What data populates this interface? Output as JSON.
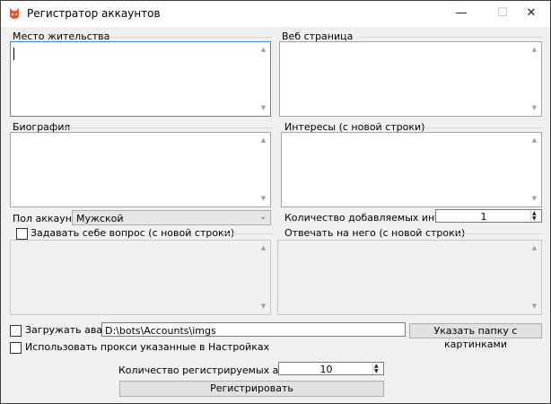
{
  "window": {
    "title": "Регистратор аккаунтов",
    "controls": {
      "minimize": "—",
      "maximize": "☐",
      "close": "✕"
    }
  },
  "groups": {
    "residence": "Место жительства",
    "webpage": "Веб страница",
    "biography": "Биография",
    "interests": "Интересы (с новой строки)"
  },
  "account_gender": {
    "label": "Пол аккаунта",
    "selected": "Мужской"
  },
  "interests_count": {
    "label": "Количество добавляемых интересов",
    "value": "1"
  },
  "ask_question": {
    "label": "Задавать себе вопрос (с новой строки)",
    "checked": false
  },
  "answer_group": "Отвечать на него (с новой строки)",
  "avatar": {
    "label": "Загружать аватар",
    "checked": false,
    "path": "D:\\bots\\Accounts\\imgs",
    "folder_button": "Указать папку с картинками"
  },
  "use_proxy": {
    "label": "Использовать прокси указанные в Настройках",
    "checked": false
  },
  "accounts_count": {
    "label": "Количество регистрируемых аккаунтов",
    "value": "10"
  },
  "register_button": "Регистрировать",
  "icons": {
    "scroll_up": "▲",
    "scroll_down": "▼",
    "combo_arrow": "⌄",
    "spin_up": "▲",
    "spin_down": "▼"
  },
  "colors": {
    "focus_border": "#3d8ed8",
    "window_bg": "#f0f0f0",
    "app_icon": "#e8562a"
  }
}
